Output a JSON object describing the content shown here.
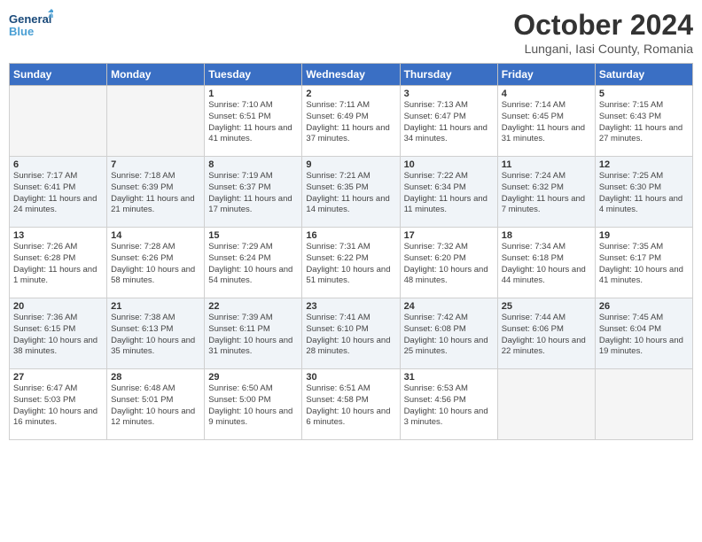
{
  "logo": {
    "line1": "General",
    "line2": "Blue"
  },
  "title": "October 2024",
  "location": "Lungani, Iasi County, Romania",
  "days_of_week": [
    "Sunday",
    "Monday",
    "Tuesday",
    "Wednesday",
    "Thursday",
    "Friday",
    "Saturday"
  ],
  "weeks": [
    [
      {
        "day": "",
        "info": ""
      },
      {
        "day": "",
        "info": ""
      },
      {
        "day": "1",
        "info": "Sunrise: 7:10 AM\nSunset: 6:51 PM\nDaylight: 11 hours and 41 minutes."
      },
      {
        "day": "2",
        "info": "Sunrise: 7:11 AM\nSunset: 6:49 PM\nDaylight: 11 hours and 37 minutes."
      },
      {
        "day": "3",
        "info": "Sunrise: 7:13 AM\nSunset: 6:47 PM\nDaylight: 11 hours and 34 minutes."
      },
      {
        "day": "4",
        "info": "Sunrise: 7:14 AM\nSunset: 6:45 PM\nDaylight: 11 hours and 31 minutes."
      },
      {
        "day": "5",
        "info": "Sunrise: 7:15 AM\nSunset: 6:43 PM\nDaylight: 11 hours and 27 minutes."
      }
    ],
    [
      {
        "day": "6",
        "info": "Sunrise: 7:17 AM\nSunset: 6:41 PM\nDaylight: 11 hours and 24 minutes."
      },
      {
        "day": "7",
        "info": "Sunrise: 7:18 AM\nSunset: 6:39 PM\nDaylight: 11 hours and 21 minutes."
      },
      {
        "day": "8",
        "info": "Sunrise: 7:19 AM\nSunset: 6:37 PM\nDaylight: 11 hours and 17 minutes."
      },
      {
        "day": "9",
        "info": "Sunrise: 7:21 AM\nSunset: 6:35 PM\nDaylight: 11 hours and 14 minutes."
      },
      {
        "day": "10",
        "info": "Sunrise: 7:22 AM\nSunset: 6:34 PM\nDaylight: 11 hours and 11 minutes."
      },
      {
        "day": "11",
        "info": "Sunrise: 7:24 AM\nSunset: 6:32 PM\nDaylight: 11 hours and 7 minutes."
      },
      {
        "day": "12",
        "info": "Sunrise: 7:25 AM\nSunset: 6:30 PM\nDaylight: 11 hours and 4 minutes."
      }
    ],
    [
      {
        "day": "13",
        "info": "Sunrise: 7:26 AM\nSunset: 6:28 PM\nDaylight: 11 hours and 1 minute."
      },
      {
        "day": "14",
        "info": "Sunrise: 7:28 AM\nSunset: 6:26 PM\nDaylight: 10 hours and 58 minutes."
      },
      {
        "day": "15",
        "info": "Sunrise: 7:29 AM\nSunset: 6:24 PM\nDaylight: 10 hours and 54 minutes."
      },
      {
        "day": "16",
        "info": "Sunrise: 7:31 AM\nSunset: 6:22 PM\nDaylight: 10 hours and 51 minutes."
      },
      {
        "day": "17",
        "info": "Sunrise: 7:32 AM\nSunset: 6:20 PM\nDaylight: 10 hours and 48 minutes."
      },
      {
        "day": "18",
        "info": "Sunrise: 7:34 AM\nSunset: 6:18 PM\nDaylight: 10 hours and 44 minutes."
      },
      {
        "day": "19",
        "info": "Sunrise: 7:35 AM\nSunset: 6:17 PM\nDaylight: 10 hours and 41 minutes."
      }
    ],
    [
      {
        "day": "20",
        "info": "Sunrise: 7:36 AM\nSunset: 6:15 PM\nDaylight: 10 hours and 38 minutes."
      },
      {
        "day": "21",
        "info": "Sunrise: 7:38 AM\nSunset: 6:13 PM\nDaylight: 10 hours and 35 minutes."
      },
      {
        "day": "22",
        "info": "Sunrise: 7:39 AM\nSunset: 6:11 PM\nDaylight: 10 hours and 31 minutes."
      },
      {
        "day": "23",
        "info": "Sunrise: 7:41 AM\nSunset: 6:10 PM\nDaylight: 10 hours and 28 minutes."
      },
      {
        "day": "24",
        "info": "Sunrise: 7:42 AM\nSunset: 6:08 PM\nDaylight: 10 hours and 25 minutes."
      },
      {
        "day": "25",
        "info": "Sunrise: 7:44 AM\nSunset: 6:06 PM\nDaylight: 10 hours and 22 minutes."
      },
      {
        "day": "26",
        "info": "Sunrise: 7:45 AM\nSunset: 6:04 PM\nDaylight: 10 hours and 19 minutes."
      }
    ],
    [
      {
        "day": "27",
        "info": "Sunrise: 6:47 AM\nSunset: 5:03 PM\nDaylight: 10 hours and 16 minutes."
      },
      {
        "day": "28",
        "info": "Sunrise: 6:48 AM\nSunset: 5:01 PM\nDaylight: 10 hours and 12 minutes."
      },
      {
        "day": "29",
        "info": "Sunrise: 6:50 AM\nSunset: 5:00 PM\nDaylight: 10 hours and 9 minutes."
      },
      {
        "day": "30",
        "info": "Sunrise: 6:51 AM\nSunset: 4:58 PM\nDaylight: 10 hours and 6 minutes."
      },
      {
        "day": "31",
        "info": "Sunrise: 6:53 AM\nSunset: 4:56 PM\nDaylight: 10 hours and 3 minutes."
      },
      {
        "day": "",
        "info": ""
      },
      {
        "day": "",
        "info": ""
      }
    ]
  ]
}
